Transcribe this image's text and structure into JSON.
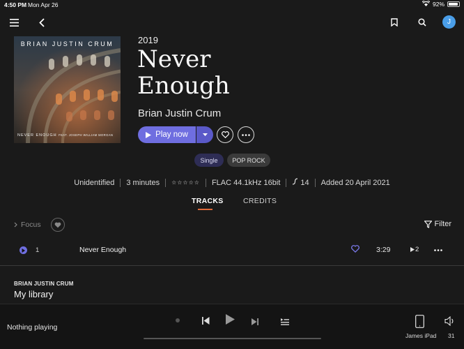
{
  "status": {
    "time": "4:50 PM",
    "date": "Mon Apr 26",
    "battery": "92%",
    "battery_level": 0.92
  },
  "header": {
    "avatar_initial": "J"
  },
  "album": {
    "cover_artist": "BRIAN JUSTIN CRUM",
    "cover_title": "NEVER ENOUGH",
    "cover_feat": "FEAT. JOSEPH WILLIAM MORGAN",
    "year": "2019",
    "title": "Never Enough",
    "artist": "Brian Justin Crum",
    "play_label": "Play now",
    "tags": [
      "Single",
      "POP ROCK"
    ]
  },
  "meta": {
    "status": "Unidentified",
    "duration": "3 minutes",
    "rating_stars": "☆☆☆☆☆",
    "format": "FLAC 44.1kHz 16bit",
    "dynamic_range": "14",
    "added": "Added 20 April 2021"
  },
  "tabs": {
    "tracks": "TRACKS",
    "credits": "CREDITS"
  },
  "toolbar": {
    "focus": "Focus",
    "filter": "Filter"
  },
  "tracks": [
    {
      "number": "1",
      "title": "Never Enough",
      "duration": "3:29",
      "versions": "2"
    }
  ],
  "library": {
    "artist": "BRIAN JUSTIN CRUM",
    "title": "My library"
  },
  "player": {
    "now_playing": "Nothing playing",
    "device": "James iPad",
    "volume": "31"
  },
  "colors": {
    "accent": "#6f6ee0",
    "tab_underline": "#e06b3b",
    "avatar": "#4a9ee8"
  }
}
